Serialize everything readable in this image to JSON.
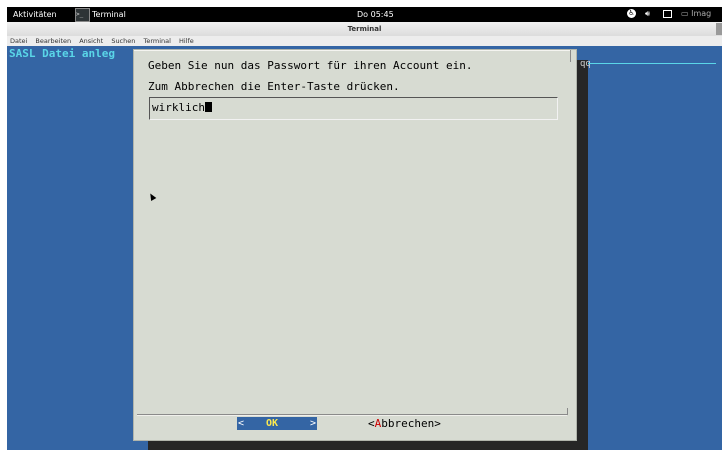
{
  "topbar": {
    "activities": "Aktivitäten",
    "app_name": "Terminal",
    "clock": "Do 05:45",
    "user_fragment": "Imag"
  },
  "window": {
    "title": "Terminal"
  },
  "menubar": {
    "items": [
      "Datei",
      "Bearbeiten",
      "Ansicht",
      "Suchen",
      "Terminal",
      "Hilfe"
    ]
  },
  "background": {
    "title": "SASL Datei anleg",
    "fragment": "qq"
  },
  "dialog": {
    "line1": "Geben Sie nun das Passwort für ihren Account ein.",
    "line2": "Zum Abbrechen die Enter-Taste drücken.",
    "input_value": "wirklich",
    "ok_left": "<",
    "ok_label": "OK",
    "ok_right": ">",
    "cancel_prefix": "<",
    "cancel_hotkey": "A",
    "cancel_rest": "bbrechen>"
  },
  "colors": {
    "terminal_bg": "#3465a4",
    "dialog_bg": "#d7dbd2",
    "title_cyan": "#5ad6e8",
    "ok_fg": "#fce94f",
    "hotkey": "#cc0000"
  }
}
